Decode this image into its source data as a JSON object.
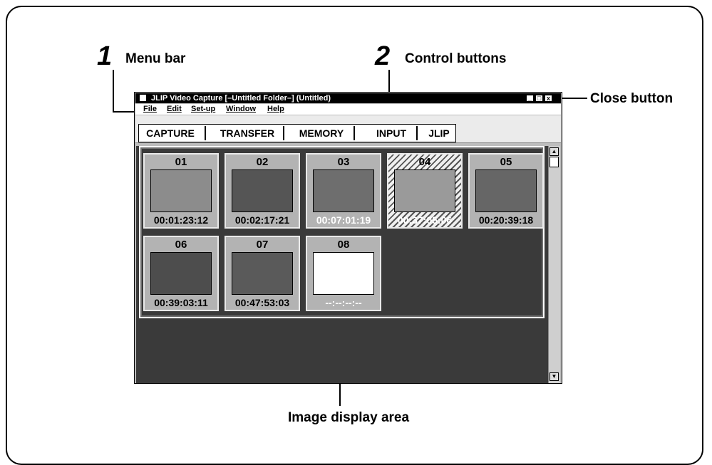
{
  "callouts": {
    "menu_bar": {
      "num": "1",
      "label": "Menu bar"
    },
    "control_buttons": {
      "num": "2",
      "label": "Control buttons"
    },
    "close_button": {
      "label": "Close button"
    },
    "image_display_area": {
      "label": "Image display area"
    }
  },
  "window": {
    "title": "JLIP Video Capture [–Untitled Folder–] (Untitled)",
    "minimize_icon": "minimize-icon",
    "maximize_icon": "maximize-icon",
    "close_symbol": "x"
  },
  "menu": [
    "File",
    "Edit",
    "Set-up",
    "Window",
    "Help"
  ],
  "controls": [
    "CAPTURE",
    "TRANSFER",
    "MEMORY",
    "INPUT",
    "JLIP"
  ],
  "thumbnails": [
    {
      "num": "01",
      "time": "00:01:23:12"
    },
    {
      "num": "02",
      "time": "00:02:17:21"
    },
    {
      "num": "03",
      "time": "00:07:01:19"
    },
    {
      "num": "04",
      "time": "00:37:05:06"
    },
    {
      "num": "05",
      "time": "00:20:39:18"
    },
    {
      "num": "06",
      "time": "00:39:03:11"
    },
    {
      "num": "07",
      "time": "00:47:53:03"
    },
    {
      "num": "08",
      "time": "--:--:--:--"
    }
  ],
  "colors": {
    "title_bar": "#000000",
    "display_bg": "#3a3a3a",
    "thumb_bg": "#b3b3b3"
  }
}
